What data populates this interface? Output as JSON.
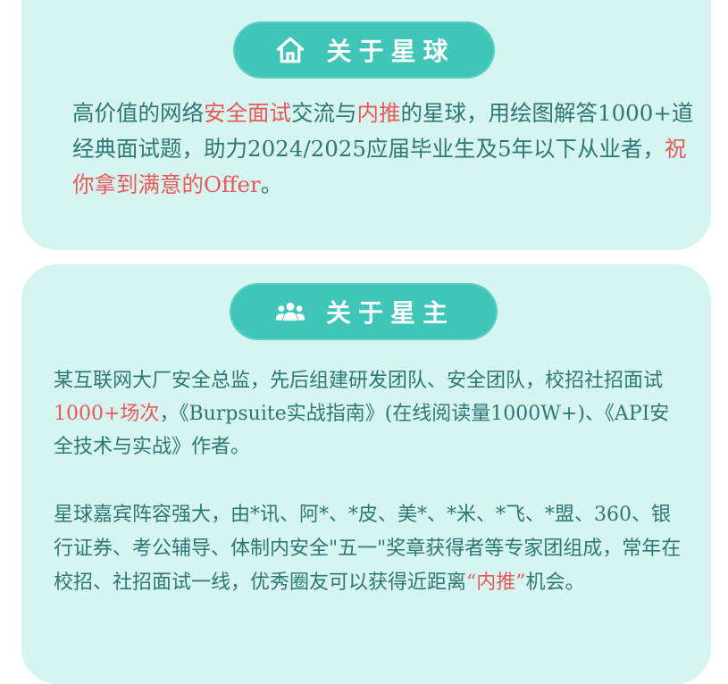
{
  "section1": {
    "title": "关于星球",
    "icon": "home-icon",
    "text": {
      "part1": "高价值的网络",
      "hl1": "安全面试",
      "part2": "交流与",
      "hl2": "内推",
      "part3": "的星球，用绘图解答1000+道经典面试题，助力2024/2025应届毕业生及5年以下从业者，",
      "hl3": "祝你拿到满意的Offer",
      "part4": "。"
    }
  },
  "section2": {
    "title": "关于星主",
    "icon": "group-icon",
    "para1": {
      "part1": "某互联网大厂安全总监，先后组建研发团队、安全团队，校招社招面试",
      "hl1": "1000+场次",
      "part2": "，《Burpsuite实战指南》(在线阅读量1000W+)、《API安全技术与实战》作者。"
    },
    "para2": {
      "part1": "星球嘉宾阵容强大，由*讯、阿*、*皮、美*、*米、*飞、*盟、360、银行证券、考公辅导、体制内安全\"五一\"奖章获得者等专家团组成，常年在校招、社招面试一线，优秀圈友可以获得近距离",
      "hl1": "“内推”",
      "part2": "机会。"
    }
  },
  "colors": {
    "card_bg": "#d7f5f0",
    "pill_bg": "#3fc6b9",
    "text": "#2c7876",
    "highlight": "#e9595a"
  }
}
